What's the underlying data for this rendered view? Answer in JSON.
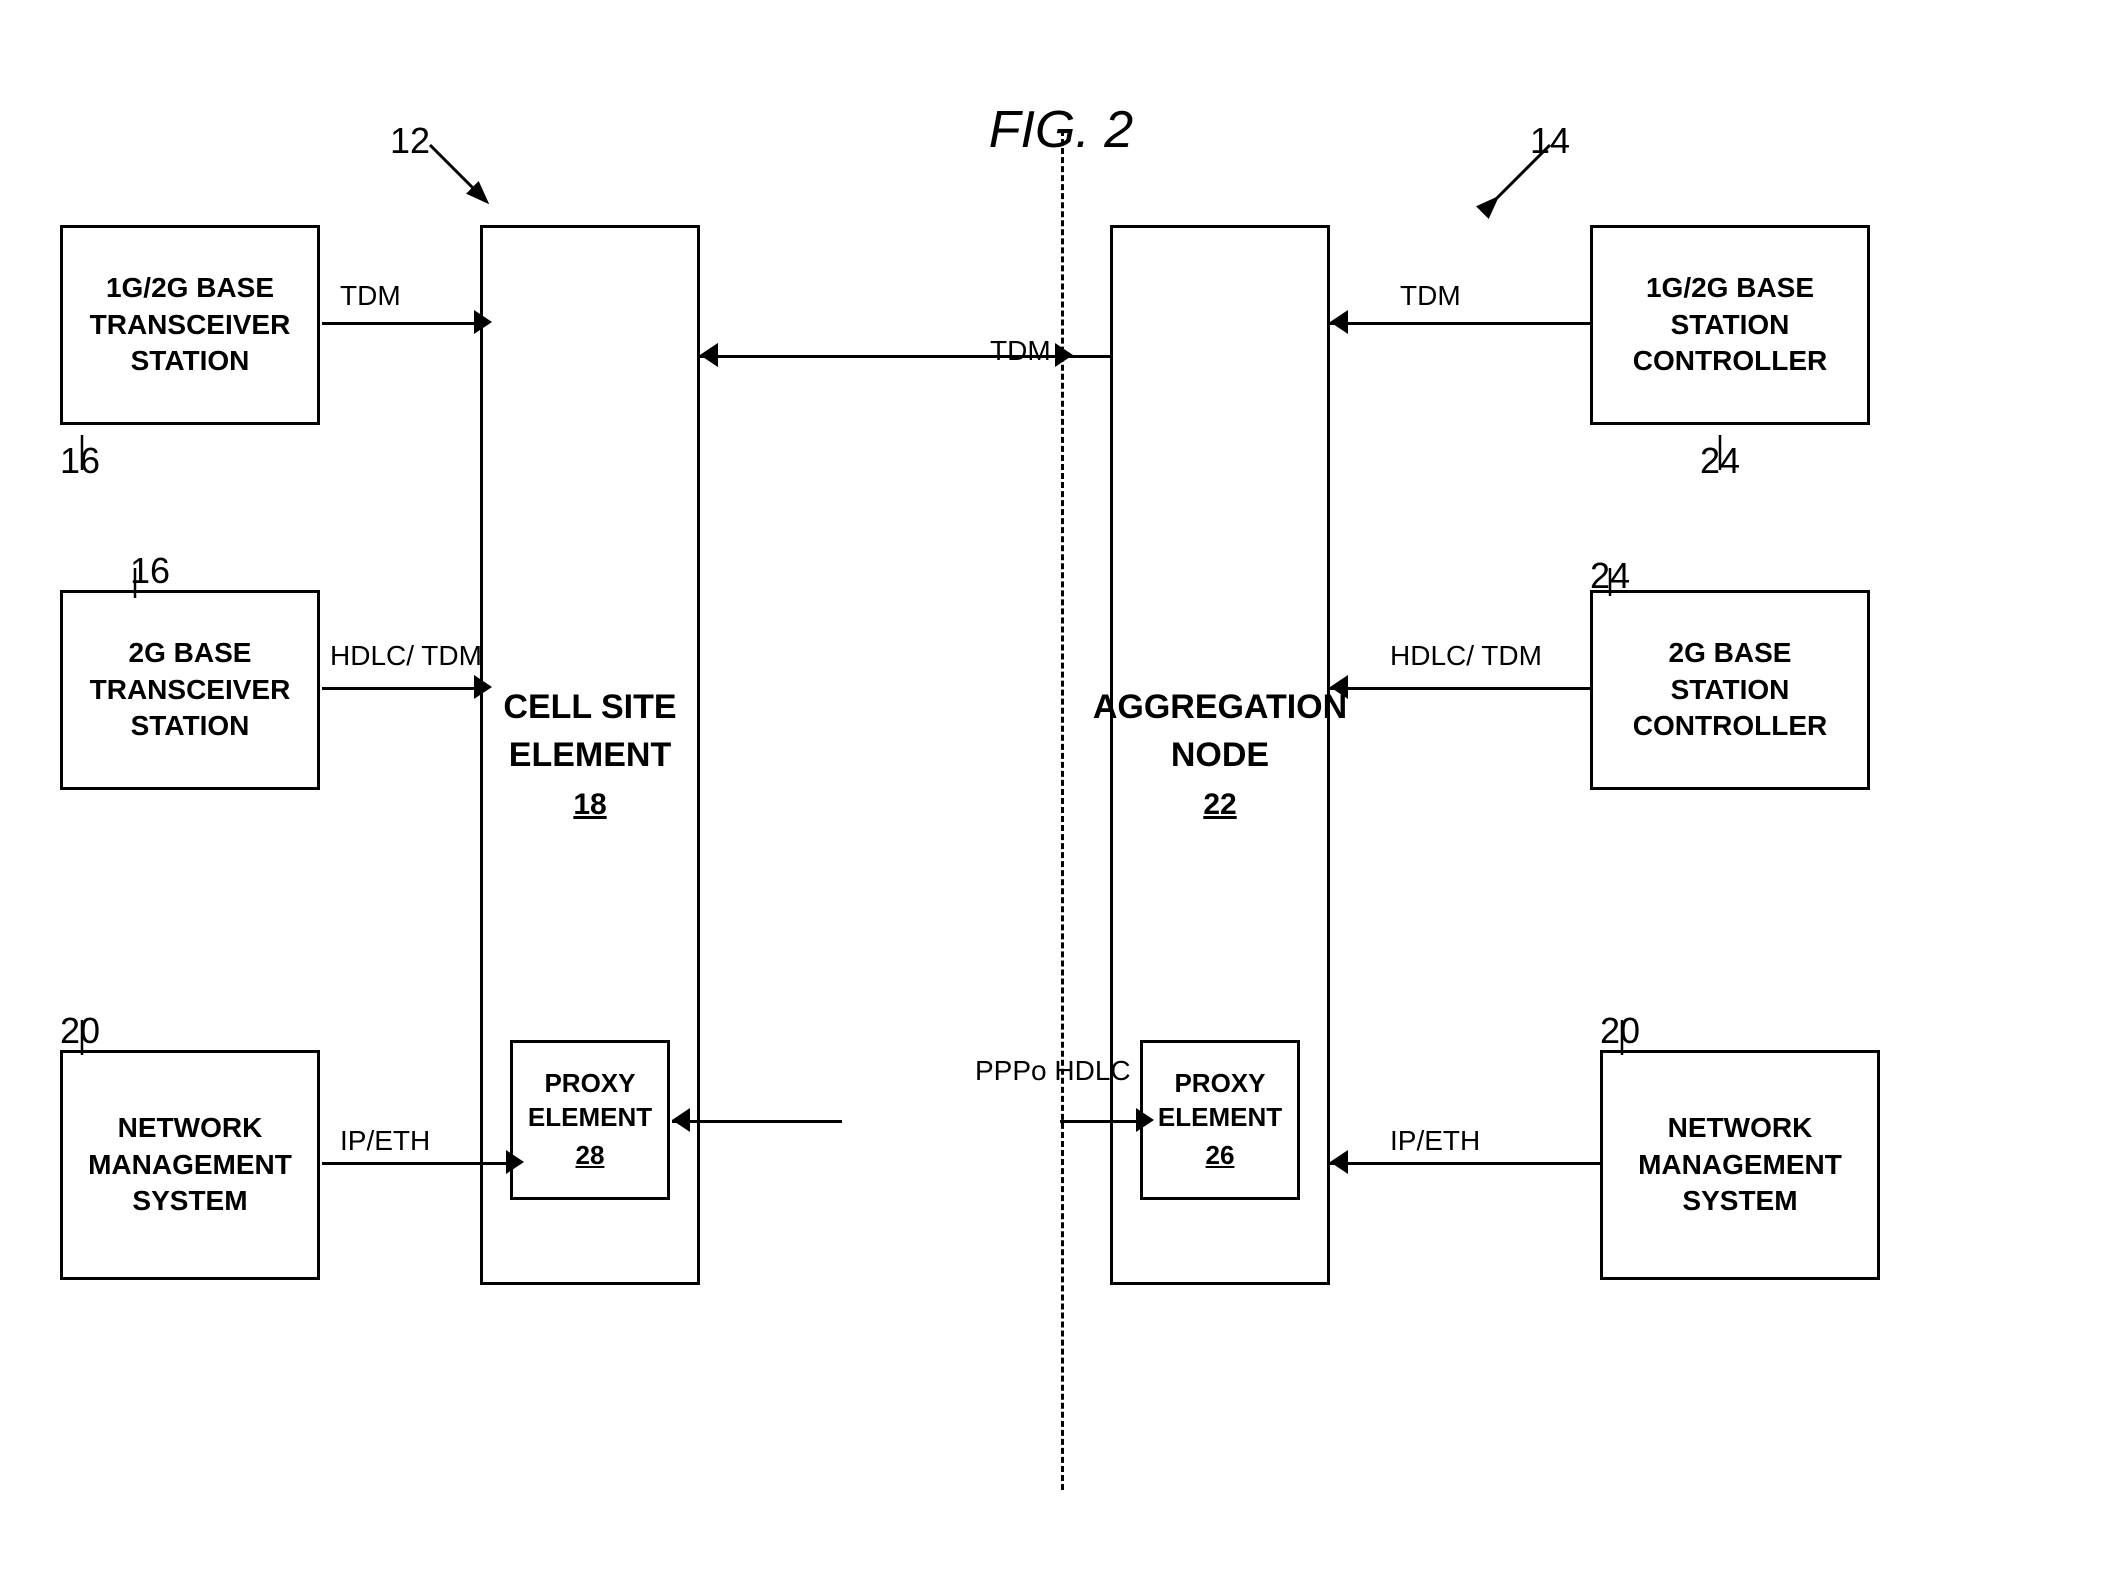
{
  "figure": {
    "title": "FIG. 2"
  },
  "refs": {
    "ref12": "12",
    "ref14": "14",
    "ref16a": "16",
    "ref16b": "16",
    "ref18": "18",
    "ref20a": "20",
    "ref20b": "20",
    "ref22": "22",
    "ref24a": "24",
    "ref24b": "24",
    "ref26": "26",
    "ref28": "28"
  },
  "boxes": {
    "bts1g2g": "1G/2G BASE\nTRANSCEIVER\nSTATION",
    "bts2g": "2G BASE\nTRANSCEIVER\nSTATION",
    "nms_left": "NETWORK\nMANAGEMENT\nSYSTEM",
    "cell_site": "CELL SITE\nELEMENT",
    "cell_site_num": "18",
    "proxy_left": "PROXY\nELEMENT",
    "proxy_left_num": "28",
    "aggregation": "AGGREGATION\nNODE",
    "aggregation_num": "22",
    "proxy_right": "PROXY\nELEMENT",
    "proxy_right_num": "26",
    "bsc1g2g": "1G/2G BASE\nSTATION\nCONTROLLER",
    "bsc2g": "2G BASE\nSTATION\nCONTROLLER",
    "nms_right": "NETWORK\nMANAGEMENT\nSYSTEM"
  },
  "labels": {
    "tdm1": "TDM",
    "tdm2": "HDLC/\nTDM",
    "tdm3": "IP/ETH",
    "tdm4": "TDM",
    "tdm5": "TDM",
    "tdm6": "HDLC/\nTDM",
    "tdm7": "IP/ETH",
    "ppphdlc": "PPPo\nHDLC"
  }
}
